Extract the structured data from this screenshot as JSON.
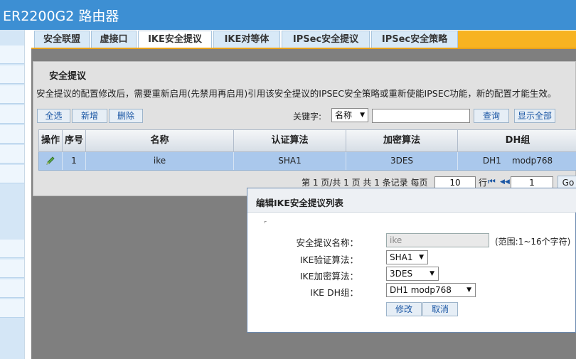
{
  "app": {
    "title": "ER2200G2 路由器"
  },
  "tabs": [
    {
      "label": "安全联盟"
    },
    {
      "label": "虚接口"
    },
    {
      "label": "IKE安全提议"
    },
    {
      "label": "IKE对等体"
    },
    {
      "label": "IPSec安全提议"
    },
    {
      "label": "IPSec安全策略"
    }
  ],
  "section": {
    "title": "安全提议",
    "notice": "安全提议的配置修改后，需要重新启用(先禁用再启用)引用该安全提议的IPSEC安全策略或重新使能IPSEC功能，新的配置才能生效。"
  },
  "toolbar": {
    "select_all": "全选",
    "add": "新增",
    "delete": "删除",
    "keyword_label": "关键字:",
    "keyword_field": "名称",
    "search": "查询",
    "show_all": "显示全部"
  },
  "table": {
    "columns": [
      "操作",
      "序号",
      "名称",
      "认证算法",
      "加密算法",
      "DH组"
    ],
    "rows": [
      {
        "index": "1",
        "name": "ike",
        "auth": "SHA1",
        "enc": "3DES",
        "dh": "DH1    modp768"
      }
    ]
  },
  "pager": {
    "summary": "第 1 页/共 1 页 共 1 条记录 每页",
    "per_page": "10",
    "row_label": "行",
    "first": "⏮",
    "prev": "◀◀",
    "page": "1",
    "go": "Go"
  },
  "dialog": {
    "title": "编辑IKE安全提议列表",
    "fields": {
      "name_label": "安全提议名称：",
      "name_value": "ike",
      "name_hint": "(范围:1~16个字符)",
      "auth_label": "IKE验证算法：",
      "auth_value": "SHA1",
      "enc_label": "IKE加密算法：",
      "enc_value": "3DES",
      "dh_label": "IKE DH组：",
      "dh_value": "DH1 modp768"
    },
    "modify": "修改",
    "cancel": "取消"
  },
  "icons": {
    "edit": "pencil-icon",
    "dropdown": "chevron-down-icon"
  },
  "colors": {
    "header": "#3d8fd3",
    "accent": "#f7b321",
    "row_selected": "#aac8ec"
  }
}
